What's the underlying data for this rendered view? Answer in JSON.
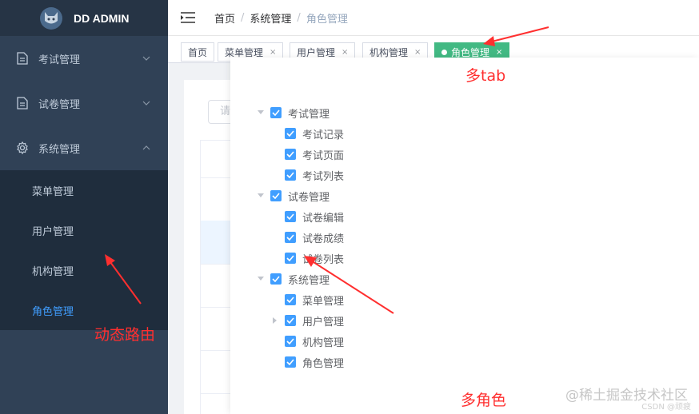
{
  "app": {
    "title": "DD ADMIN"
  },
  "sidebar": {
    "menus": [
      {
        "label": "考试管理",
        "icon": "document-icon",
        "expanded": false
      },
      {
        "label": "试卷管理",
        "icon": "document-icon",
        "expanded": false
      },
      {
        "label": "系统管理",
        "icon": "gear-icon",
        "expanded": true
      }
    ],
    "submenu": [
      {
        "label": "菜单管理",
        "active": false
      },
      {
        "label": "用户管理",
        "active": false
      },
      {
        "label": "机构管理",
        "active": false
      },
      {
        "label": "角色管理",
        "active": true
      }
    ]
  },
  "header": {
    "breadcrumb": [
      "首页",
      "系统管理",
      "角色管理"
    ],
    "separator": "/"
  },
  "tags": [
    {
      "label": "首页",
      "closable": false,
      "active": false
    },
    {
      "label": "菜单管理",
      "closable": true,
      "active": false
    },
    {
      "label": "用户管理",
      "closable": true,
      "active": false
    },
    {
      "label": "机构管理",
      "closable": true,
      "active": false
    },
    {
      "label": "角色管理",
      "closable": true,
      "active": true
    }
  ],
  "tag_close_glyph": "×",
  "main": {
    "search_placeholder": "请"
  },
  "tree": [
    {
      "label": "考试管理",
      "level": 0,
      "expand": "down",
      "checked": true
    },
    {
      "label": "考试记录",
      "level": 1,
      "expand": "none",
      "checked": true
    },
    {
      "label": "考试页面",
      "level": 1,
      "expand": "none",
      "checked": true
    },
    {
      "label": "考试列表",
      "level": 1,
      "expand": "none",
      "checked": true
    },
    {
      "label": "试卷管理",
      "level": 0,
      "expand": "down",
      "checked": true
    },
    {
      "label": "试卷编辑",
      "level": 1,
      "expand": "none",
      "checked": true
    },
    {
      "label": "试卷成绩",
      "level": 1,
      "expand": "none",
      "checked": true
    },
    {
      "label": "试卷列表",
      "level": 1,
      "expand": "none",
      "checked": true
    },
    {
      "label": "系统管理",
      "level": 0,
      "expand": "down",
      "checked": true
    },
    {
      "label": "菜单管理",
      "level": 1,
      "expand": "none",
      "checked": true
    },
    {
      "label": "用户管理",
      "level": 1,
      "expand": "right",
      "checked": true
    },
    {
      "label": "机构管理",
      "level": 1,
      "expand": "none",
      "checked": true
    },
    {
      "label": "角色管理",
      "level": 1,
      "expand": "none",
      "checked": true
    }
  ],
  "annotations": {
    "multi_tab": "多tab",
    "dynamic_route": "动态路由",
    "multi_role": "多角色",
    "color": "#ff2f2f"
  },
  "watermark": {
    "text": "@稀土掘金技术社区",
    "sub": "CSDN @顽疲"
  },
  "colors": {
    "sidebar": "#304156",
    "accent": "#409eff",
    "active_tag": "#42b983"
  }
}
